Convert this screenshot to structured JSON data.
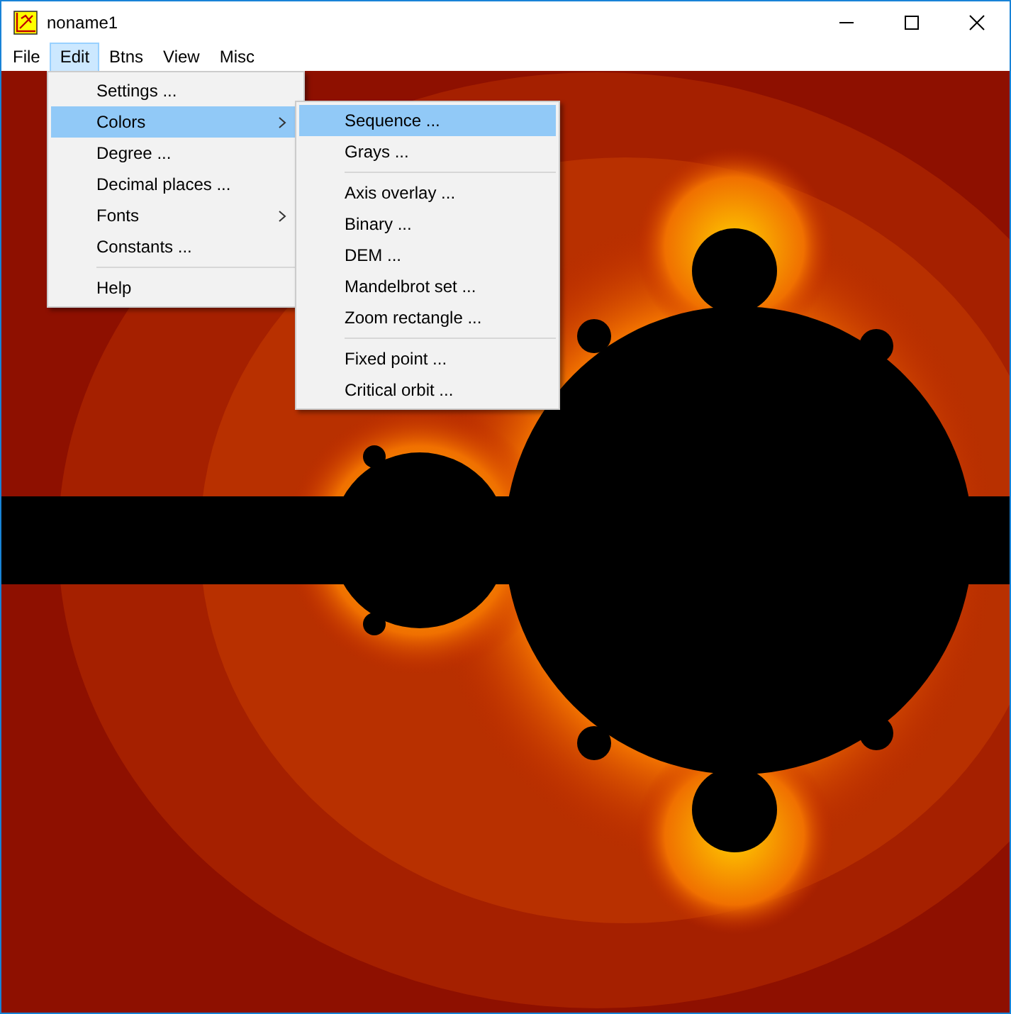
{
  "window": {
    "title": "noname1"
  },
  "menubar": [
    {
      "label": "File",
      "selected": false
    },
    {
      "label": "Edit",
      "selected": true
    },
    {
      "label": "Btns",
      "selected": false
    },
    {
      "label": "View",
      "selected": false
    },
    {
      "label": "Misc",
      "selected": false
    }
  ],
  "edit_menu": [
    {
      "kind": "item",
      "label": "Settings ...",
      "selected": false
    },
    {
      "kind": "submenu",
      "label": "Colors",
      "selected": true
    },
    {
      "kind": "item",
      "label": "Degree ...",
      "selected": false
    },
    {
      "kind": "item",
      "label": "Decimal places ...",
      "selected": false
    },
    {
      "kind": "submenu",
      "label": "Fonts",
      "selected": false
    },
    {
      "kind": "item",
      "label": "Constants ...",
      "selected": false
    },
    {
      "kind": "separator"
    },
    {
      "kind": "item",
      "label": "Help",
      "selected": false
    }
  ],
  "colors_submenu": [
    {
      "kind": "item",
      "label": "Sequence ...",
      "selected": true
    },
    {
      "kind": "item",
      "label": "Grays ...",
      "selected": false
    },
    {
      "kind": "separator"
    },
    {
      "kind": "item",
      "label": "Axis overlay ...",
      "selected": false
    },
    {
      "kind": "item",
      "label": "Binary ...",
      "selected": false
    },
    {
      "kind": "item",
      "label": "DEM ...",
      "selected": false
    },
    {
      "kind": "item",
      "label": "Mandelbrot set ...",
      "selected": false
    },
    {
      "kind": "item",
      "label": "Zoom rectangle ...",
      "selected": false
    },
    {
      "kind": "separator"
    },
    {
      "kind": "item",
      "label": "Fixed point ...",
      "selected": false
    },
    {
      "kind": "item",
      "label": "Critical orbit ...",
      "selected": false
    }
  ]
}
